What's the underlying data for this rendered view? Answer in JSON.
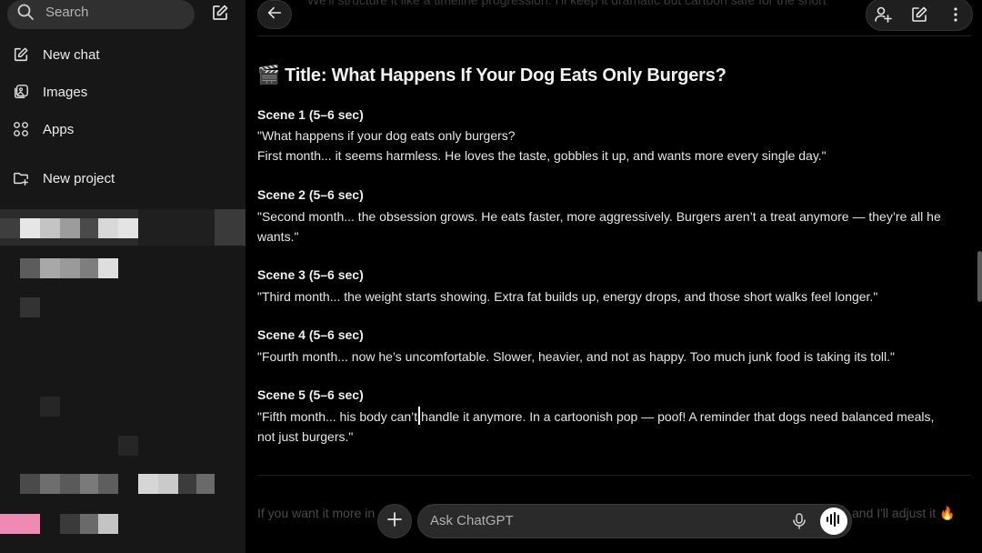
{
  "sidebar": {
    "search_label": "Search",
    "new_chat": "New chat",
    "images": "Images",
    "apps": "Apps",
    "new_project": "New project"
  },
  "main": {
    "title_emoji": "🎬",
    "title": "Title: What Happens If Your Dog Eats Only Burgers?",
    "top_faded_text": "We'll structure it like a timeline progression. I'll keep it dramatic but cartoon safe for the short",
    "scenes": [
      {
        "heading": "Scene 1 (5–6 sec)",
        "line1": "\"What happens if your dog eats only burgers?",
        "line2": "First month... it seems harmless. He loves the taste, gobbles it up, and wants more every single day.\""
      },
      {
        "heading": "Scene 2 (5–6 sec)",
        "text": "\"Second month... the obsession grows. He eats faster, more aggressively. Burgers aren’t a treat anymore — they’re all he wants.\""
      },
      {
        "heading": "Scene 3 (5–6 sec)",
        "text": "\"Third month... the weight starts showing. Extra fat builds up, energy drops, and those short walks feel longer.\""
      },
      {
        "heading": "Scene 4 (5–6 sec)",
        "text": "\"Fourth month... now he’s uncomfortable. Slower, heavier, and not as happy. Too much junk food is taking its toll.\""
      },
      {
        "heading": "Scene 5 (5–6 sec)",
        "text_before_caret": "\"Fifth month... his body can’t",
        "text_after_caret": "handle it anymore. In a cartoonish pop — poof! A reminder that dogs need balanced meals, not just burgers.\""
      }
    ],
    "bottom_faded_left": "If you want it more in",
    "bottom_faded_right": "and I'll adjust it 🔥"
  },
  "composer": {
    "placeholder": "Ask ChatGPT"
  },
  "colors": {
    "sidebar_bg": "#171717",
    "main_bg": "#000000",
    "pink_accent": "#f08ab4"
  }
}
